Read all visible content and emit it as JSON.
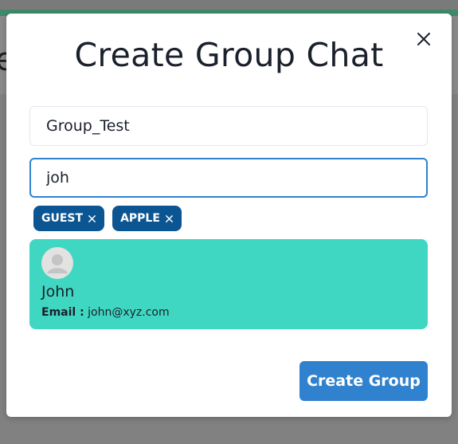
{
  "modal": {
    "title": "Create Group Chat",
    "close_icon": "close-icon"
  },
  "form": {
    "group_name_value": "Group_Test",
    "search_value": "joh"
  },
  "selected_users": [
    {
      "label": "GUEST",
      "remove_icon": "close-icon"
    },
    {
      "label": "APPLE",
      "remove_icon": "close-icon"
    }
  ],
  "search_results": [
    {
      "name": "John",
      "email_label": "Email :",
      "email": "john@xyz.com",
      "avatar_icon": "user-avatar-icon"
    }
  ],
  "actions": {
    "create_label": "Create Group"
  },
  "colors": {
    "tag_bg": "#0b5593",
    "result_bg": "#40d7c2",
    "primary_button": "#3182ce",
    "focus_border": "#3182ce"
  }
}
